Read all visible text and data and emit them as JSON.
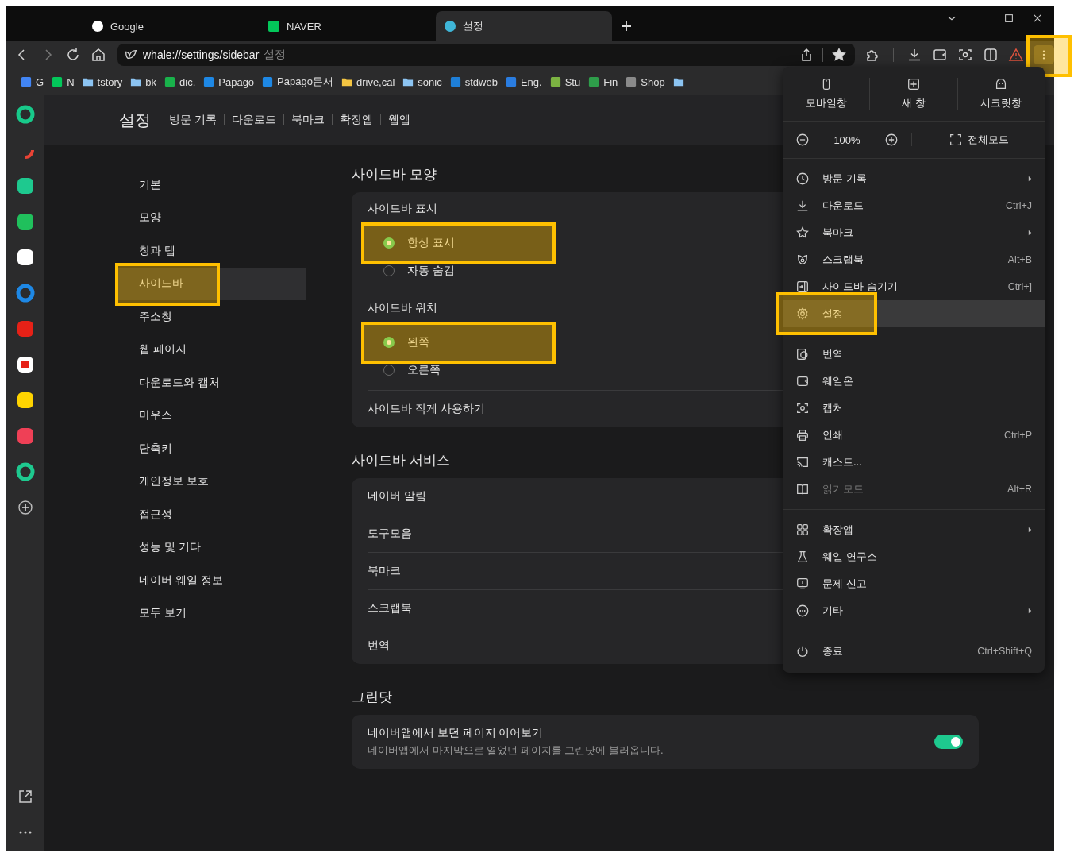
{
  "tabs": [
    {
      "title": "Google",
      "selected": false
    },
    {
      "title": "NAVER",
      "selected": false
    },
    {
      "title": "설정",
      "selected": true
    }
  ],
  "address": {
    "url": "whale://settings/sidebar",
    "page_title": "설정"
  },
  "menu_button": {
    "highlighted": true
  },
  "bookmarks": [
    {
      "label": "G",
      "kind": "site",
      "color": "#4285f4"
    },
    {
      "label": "N",
      "kind": "site",
      "color": "#03c75a"
    },
    {
      "label": "tstory",
      "kind": "folder",
      "color": "#8cc4f2"
    },
    {
      "label": "bk",
      "kind": "folder",
      "color": "#8cc4f2"
    },
    {
      "label": "dic.",
      "kind": "site",
      "color": "#19b24b"
    },
    {
      "label": "Papago",
      "kind": "site",
      "color": "#1e88e5"
    },
    {
      "label": "Papago문서",
      "kind": "site",
      "color": "#1e88e5"
    },
    {
      "label": "drive,cal",
      "kind": "folder",
      "color": "#f4c542"
    },
    {
      "label": "sonic",
      "kind": "folder",
      "color": "#8cc4f2"
    },
    {
      "label": "stdweb",
      "kind": "site",
      "color": "#1e7fd8"
    },
    {
      "label": "Eng.",
      "kind": "site",
      "color": "#2a7de1"
    },
    {
      "label": "Stu",
      "kind": "site",
      "color": "#7cb342"
    },
    {
      "label": "Fin",
      "kind": "site",
      "color": "#2e9d4a"
    },
    {
      "label": "Shop",
      "kind": "site",
      "color": "#8a8a8a"
    },
    {
      "kind": "folder",
      "color": "#8cc4f2"
    }
  ],
  "settings": {
    "title": "설정",
    "header_links": [
      "방문 기록",
      "다운로드",
      "북마크",
      "확장앱",
      "웹앱"
    ],
    "nav": [
      {
        "label": "기본",
        "selected": false,
        "highlighted": false
      },
      {
        "label": "모양",
        "selected": false,
        "highlighted": false
      },
      {
        "label": "창과 탭",
        "selected": false,
        "highlighted": false
      },
      {
        "label": "사이드바",
        "selected": true,
        "highlighted": true
      },
      {
        "label": "주소창",
        "selected": false,
        "highlighted": false
      },
      {
        "label": "웹 페이지",
        "selected": false,
        "highlighted": false
      },
      {
        "label": "다운로드와 캡처",
        "selected": false,
        "highlighted": false
      },
      {
        "label": "마우스",
        "selected": false,
        "highlighted": false
      },
      {
        "label": "단축키",
        "selected": false,
        "highlighted": false
      },
      {
        "label": "개인정보 보호",
        "selected": false,
        "highlighted": false
      },
      {
        "label": "접근성",
        "selected": false,
        "highlighted": false
      },
      {
        "label": "성능 및 기타",
        "selected": false,
        "highlighted": false
      },
      {
        "label": "네이버 웨일 정보",
        "selected": false,
        "highlighted": false
      },
      {
        "label": "모두 보기",
        "selected": false,
        "highlighted": false
      }
    ],
    "sections": [
      {
        "title": "사이드바 모양",
        "rows": [
          {
            "kind": "radio-group",
            "label": "사이드바 표시",
            "options": [
              {
                "label": "항상 표시",
                "selected": true,
                "highlighted": true
              },
              {
                "label": "자동 숨김",
                "selected": false,
                "highlighted": false
              }
            ]
          },
          {
            "kind": "radio-group",
            "label": "사이드바 위치",
            "options": [
              {
                "label": "왼쪽",
                "selected": true,
                "highlighted": true
              },
              {
                "label": "오른쪽",
                "selected": false,
                "highlighted": false
              }
            ]
          },
          {
            "kind": "plain",
            "label": "사이드바 작게 사용하기"
          }
        ]
      },
      {
        "title": "사이드바 서비스",
        "rows": [
          {
            "kind": "plain",
            "label": "네이버 알림"
          },
          {
            "kind": "plain",
            "label": "도구모음"
          },
          {
            "kind": "plain",
            "label": "북마크"
          },
          {
            "kind": "plain",
            "label": "스크랩북"
          },
          {
            "kind": "plain",
            "label": "번역"
          }
        ]
      },
      {
        "title": "그린닷",
        "rows": [
          {
            "kind": "toggle",
            "label": "네이버앱에서 보던 페이지 이어보기",
            "description": "네이버앱에서 마지막으로 열었던 페이지를 그린닷에 불러옵니다.",
            "on": true
          }
        ]
      }
    ]
  },
  "menu": {
    "actions": [
      "모바일창",
      "새 창",
      "시크릿창"
    ],
    "zoom": {
      "value": "100%",
      "fullscreen": "전체모드"
    },
    "groups": [
      [
        {
          "label": "방문 기록",
          "submenu": true,
          "disabled": false,
          "hovered": false,
          "highlighted": false
        },
        {
          "label": "다운로드",
          "shortcut": "Ctrl+J",
          "submenu": false,
          "disabled": false,
          "hovered": false,
          "highlighted": false
        },
        {
          "label": "북마크",
          "submenu": true,
          "disabled": false,
          "hovered": false,
          "highlighted": false
        },
        {
          "label": "스크랩북",
          "shortcut": "Alt+B",
          "submenu": false,
          "disabled": false,
          "hovered": false,
          "highlighted": false
        },
        {
          "label": "사이드바 숨기기",
          "shortcut": "Ctrl+]",
          "submenu": false,
          "disabled": false,
          "hovered": false,
          "highlighted": false
        },
        {
          "label": "설정",
          "submenu": false,
          "disabled": false,
          "hovered": true,
          "highlighted": true
        }
      ],
      [
        {
          "label": "번역",
          "submenu": false,
          "disabled": false,
          "hovered": false,
          "highlighted": false
        },
        {
          "label": "웨일온",
          "submenu": false,
          "disabled": false,
          "hovered": false,
          "highlighted": false
        },
        {
          "label": "캡처",
          "submenu": false,
          "disabled": false,
          "hovered": false,
          "highlighted": false
        },
        {
          "label": "인쇄",
          "shortcut": "Ctrl+P",
          "submenu": false,
          "disabled": false,
          "hovered": false,
          "highlighted": false
        },
        {
          "label": "캐스트...",
          "submenu": false,
          "disabled": false,
          "hovered": false,
          "highlighted": false
        },
        {
          "label": "읽기모드",
          "shortcut": "Alt+R",
          "submenu": false,
          "disabled": true,
          "hovered": false,
          "highlighted": false
        }
      ],
      [
        {
          "label": "확장앱",
          "submenu": true,
          "disabled": false,
          "hovered": false,
          "highlighted": false
        },
        {
          "label": "웨일 연구소",
          "submenu": false,
          "disabled": false,
          "hovered": false,
          "highlighted": false
        },
        {
          "label": "문제 신고",
          "submenu": false,
          "disabled": false,
          "hovered": false,
          "highlighted": false
        },
        {
          "label": "기타",
          "submenu": true,
          "disabled": false,
          "hovered": false,
          "highlighted": false
        }
      ],
      [
        {
          "label": "종료",
          "shortcut": "Ctrl+Shift+Q",
          "submenu": false,
          "disabled": false,
          "hovered": false,
          "highlighted": false
        }
      ]
    ]
  }
}
